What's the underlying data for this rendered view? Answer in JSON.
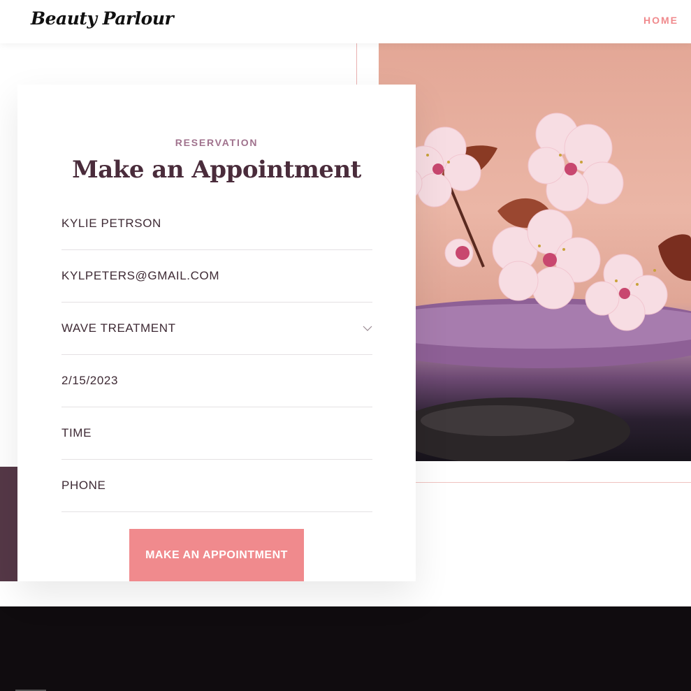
{
  "header": {
    "logo": "Beauty Parlour",
    "nav": {
      "home_label": "HOME"
    }
  },
  "hero_image": {
    "subject": "pink cherry blossoms on purple salt and spa stones"
  },
  "form": {
    "eyebrow": "RESERVATION",
    "title": "Make an Appointment",
    "fields": [
      {
        "value": "KYLIE PETRSON"
      },
      {
        "value": "KYLPETERS@GMAIL.COM"
      },
      {
        "value": "WAVE TREATMENT",
        "icon": "chevron-down-icon"
      },
      {
        "value": "2/15/2023"
      },
      {
        "value": "TIME"
      },
      {
        "value": "PHONE"
      }
    ],
    "submit_label": "MAKE AN APPOINTMENT"
  },
  "colors": {
    "accent": "#f08a8d",
    "eyebrow": "#a0728d",
    "title": "#4a2c3b",
    "side_strip": "#553847",
    "footer": "#100c0f"
  }
}
